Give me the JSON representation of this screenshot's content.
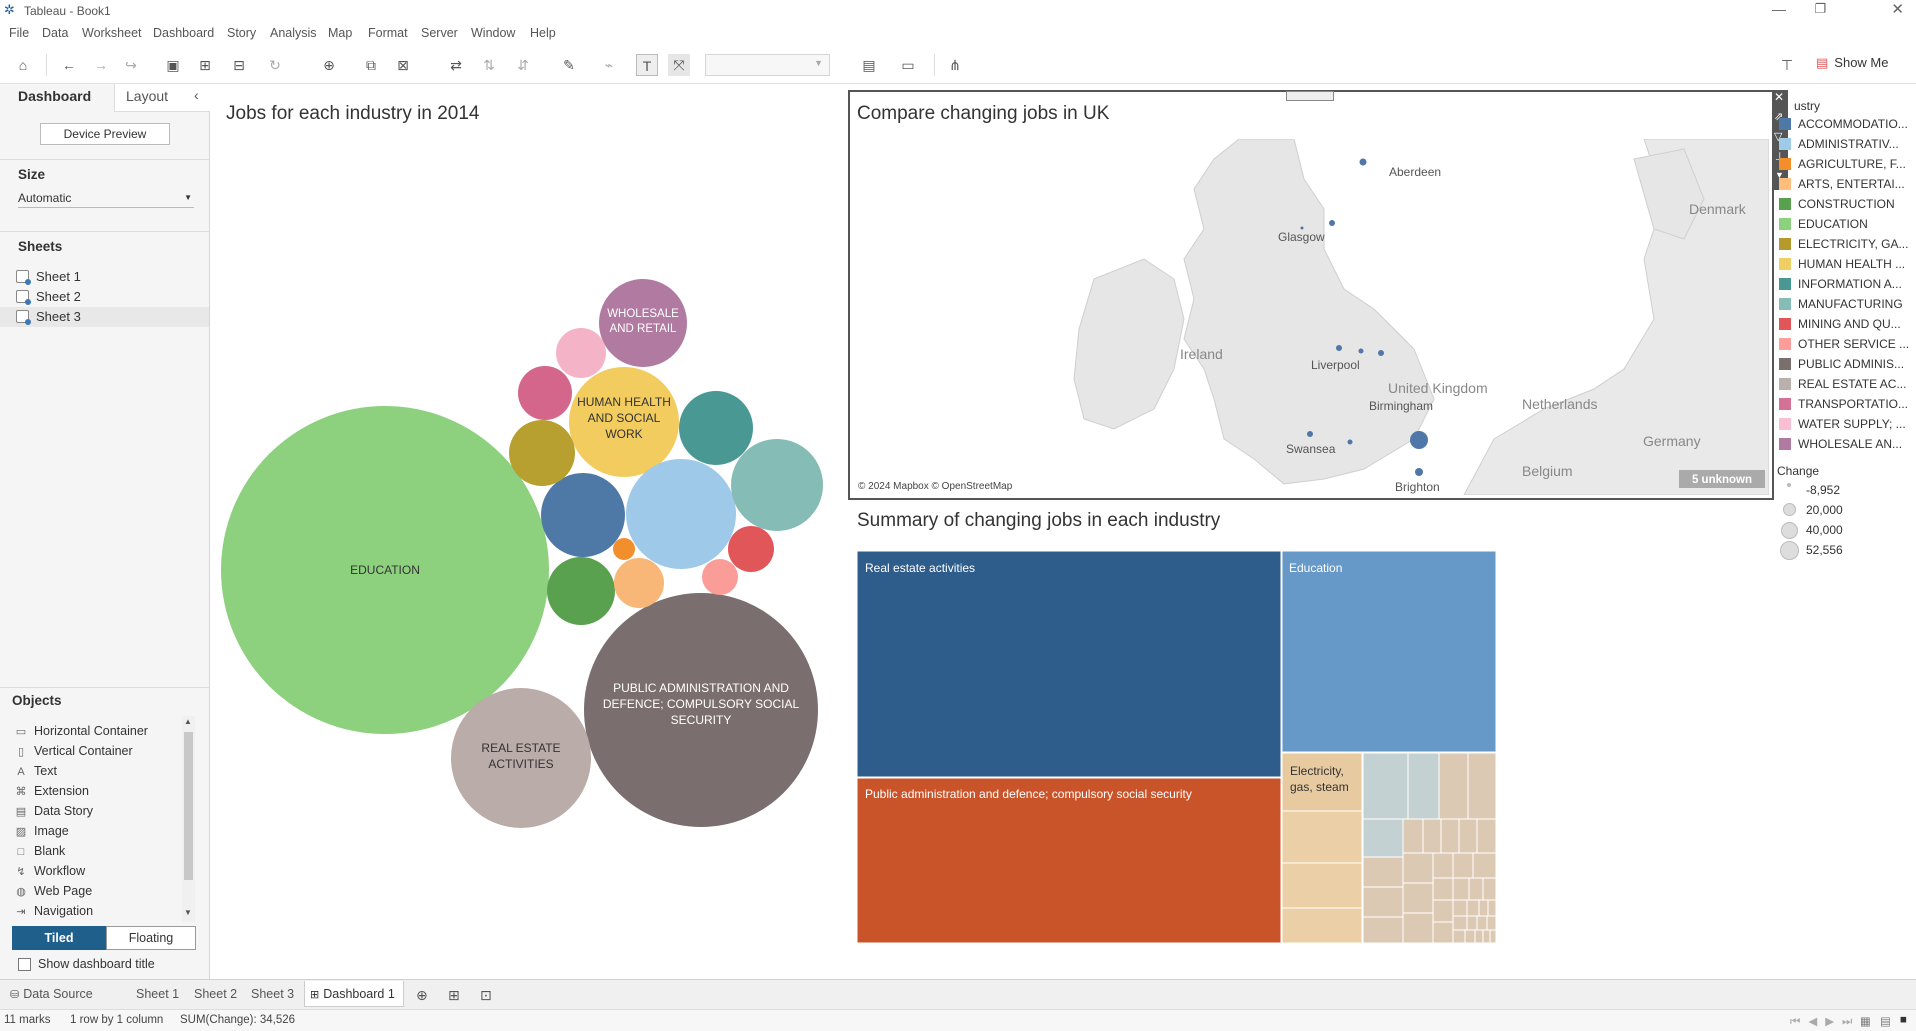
{
  "app": {
    "title": "Tableau - Book1"
  },
  "menu": [
    "File",
    "Data",
    "Worksheet",
    "Dashboard",
    "Story",
    "Analysis",
    "Map",
    "Format",
    "Server",
    "Window",
    "Help"
  ],
  "toolbar": {
    "show_me_label": "Show Me"
  },
  "left_pane": {
    "tabs": {
      "dashboard": "Dashboard",
      "layout": "Layout"
    },
    "device_preview_label": "Device Preview",
    "size_header": "Size",
    "size_value": "Automatic",
    "sheets_header": "Sheets",
    "sheets": [
      "Sheet 1",
      "Sheet 2",
      "Sheet 3"
    ],
    "objects_header": "Objects",
    "objects": [
      {
        "label": "Horizontal Container",
        "icon": "horizontal-container-icon"
      },
      {
        "label": "Vertical Container",
        "icon": "vertical-container-icon"
      },
      {
        "label": "Text",
        "icon": "text-icon"
      },
      {
        "label": "Extension",
        "icon": "extension-icon"
      },
      {
        "label": "Data Story",
        "icon": "data-story-icon"
      },
      {
        "label": "Image",
        "icon": "image-icon"
      },
      {
        "label": "Blank",
        "icon": "blank-icon"
      },
      {
        "label": "Workflow",
        "icon": "workflow-icon"
      },
      {
        "label": "Web Page",
        "icon": "web-page-icon"
      },
      {
        "label": "Navigation",
        "icon": "navigation-icon"
      }
    ],
    "tiled_label": "Tiled",
    "floating_label": "Floating",
    "show_title_label": "Show dashboard title"
  },
  "dashboard": {
    "bubble_title": "Jobs for each industry in 2014",
    "map_title": "Compare changing jobs in UK",
    "treemap_title": "Summary of changing jobs in each industry"
  },
  "chart_data": [
    {
      "type": "bubble",
      "title": "Jobs for each industry in 2014",
      "bubbles": [
        {
          "label": "EDUCATION",
          "color": "#8dd17e"
        },
        {
          "label": "PUBLIC ADMINISTRATION AND DEFENCE; COMPULSORY SOCIAL SECURITY",
          "color": "#7a6e6e"
        },
        {
          "label": "REAL ESTATE ACTIVITIES",
          "color": "#b9aca9"
        },
        {
          "label": "HUMAN HEALTH AND SOCIAL WORK",
          "color": "#f2cc5e"
        },
        {
          "label": "WHOLESALE AND RETAIL",
          "color": "#b07aa1"
        },
        {
          "label": "",
          "color": "#9fc9e8"
        },
        {
          "label": "",
          "color": "#4e79a7"
        },
        {
          "label": "",
          "color": "#86bcb6"
        },
        {
          "label": "",
          "color": "#499894"
        },
        {
          "label": "",
          "color": "#b8a030"
        },
        {
          "label": "",
          "color": "#d4668b"
        },
        {
          "label": "",
          "color": "#f5b3c8"
        },
        {
          "label": "",
          "color": "#59a14f"
        },
        {
          "label": "",
          "color": "#f8b677"
        },
        {
          "label": "",
          "color": "#e15759"
        },
        {
          "label": "",
          "color": "#fa9d99"
        },
        {
          "label": "",
          "color": "#f28e2b"
        }
      ]
    },
    {
      "type": "map",
      "title": "Compare changing jobs in UK",
      "cities": [
        "Aberdeen",
        "Glasgow",
        "Liverpool",
        "Birmingham",
        "Swansea",
        "Brighton"
      ],
      "countries": [
        "Ireland",
        "United Kingdom",
        "Denmark",
        "Netherlands",
        "Germany",
        "Belgium"
      ],
      "attribution": "© 2024 Mapbox © OpenStreetMap",
      "unknown_badge": "5 unknown"
    },
    {
      "type": "treemap",
      "title": "Summary of changing jobs in each industry",
      "labels": [
        "Real estate activities",
        "Education",
        "Public administration and defence; compulsory social security",
        "Electricity, gas, steam"
      ]
    }
  ],
  "legend": {
    "header": "ustry",
    "items": [
      {
        "label": "ACCOMMODATIO...",
        "color": "#4e79a7"
      },
      {
        "label": "ADMINISTRATIV...",
        "color": "#a0cbe8"
      },
      {
        "label": "AGRICULTURE, F...",
        "color": "#f28e2b"
      },
      {
        "label": "ARTS, ENTERTAI...",
        "color": "#ffbe7d"
      },
      {
        "label": "CONSTRUCTION",
        "color": "#59a14f"
      },
      {
        "label": "EDUCATION",
        "color": "#8cd17d"
      },
      {
        "label": "ELECTRICITY, GA...",
        "color": "#b6992d"
      },
      {
        "label": "HUMAN HEALTH ...",
        "color": "#f1ce63"
      },
      {
        "label": "INFORMATION A...",
        "color": "#499894"
      },
      {
        "label": "MANUFACTURING",
        "color": "#86bcb6"
      },
      {
        "label": "MINING AND QU...",
        "color": "#e15759"
      },
      {
        "label": "OTHER SERVICE ...",
        "color": "#ff9d9a"
      },
      {
        "label": "PUBLIC ADMINIS...",
        "color": "#79706e"
      },
      {
        "label": "REAL ESTATE AC...",
        "color": "#bab0ac"
      },
      {
        "label": "TRANSPORTATIO...",
        "color": "#d37295"
      },
      {
        "label": "WATER SUPPLY; ...",
        "color": "#fabfd2"
      },
      {
        "label": "WHOLESALE AN...",
        "color": "#b07aa1"
      }
    ],
    "size_header": "Change",
    "size_items": [
      "-8,952",
      "20,000",
      "40,000",
      "52,556"
    ]
  },
  "bottom_tabs": [
    "Data Source",
    "Sheet 1",
    "Sheet 2",
    "Sheet 3",
    "Dashboard 1"
  ],
  "status": {
    "marks": "11 marks",
    "rows": "1 row by 1 column",
    "sum": "SUM(Change): 34,526"
  }
}
